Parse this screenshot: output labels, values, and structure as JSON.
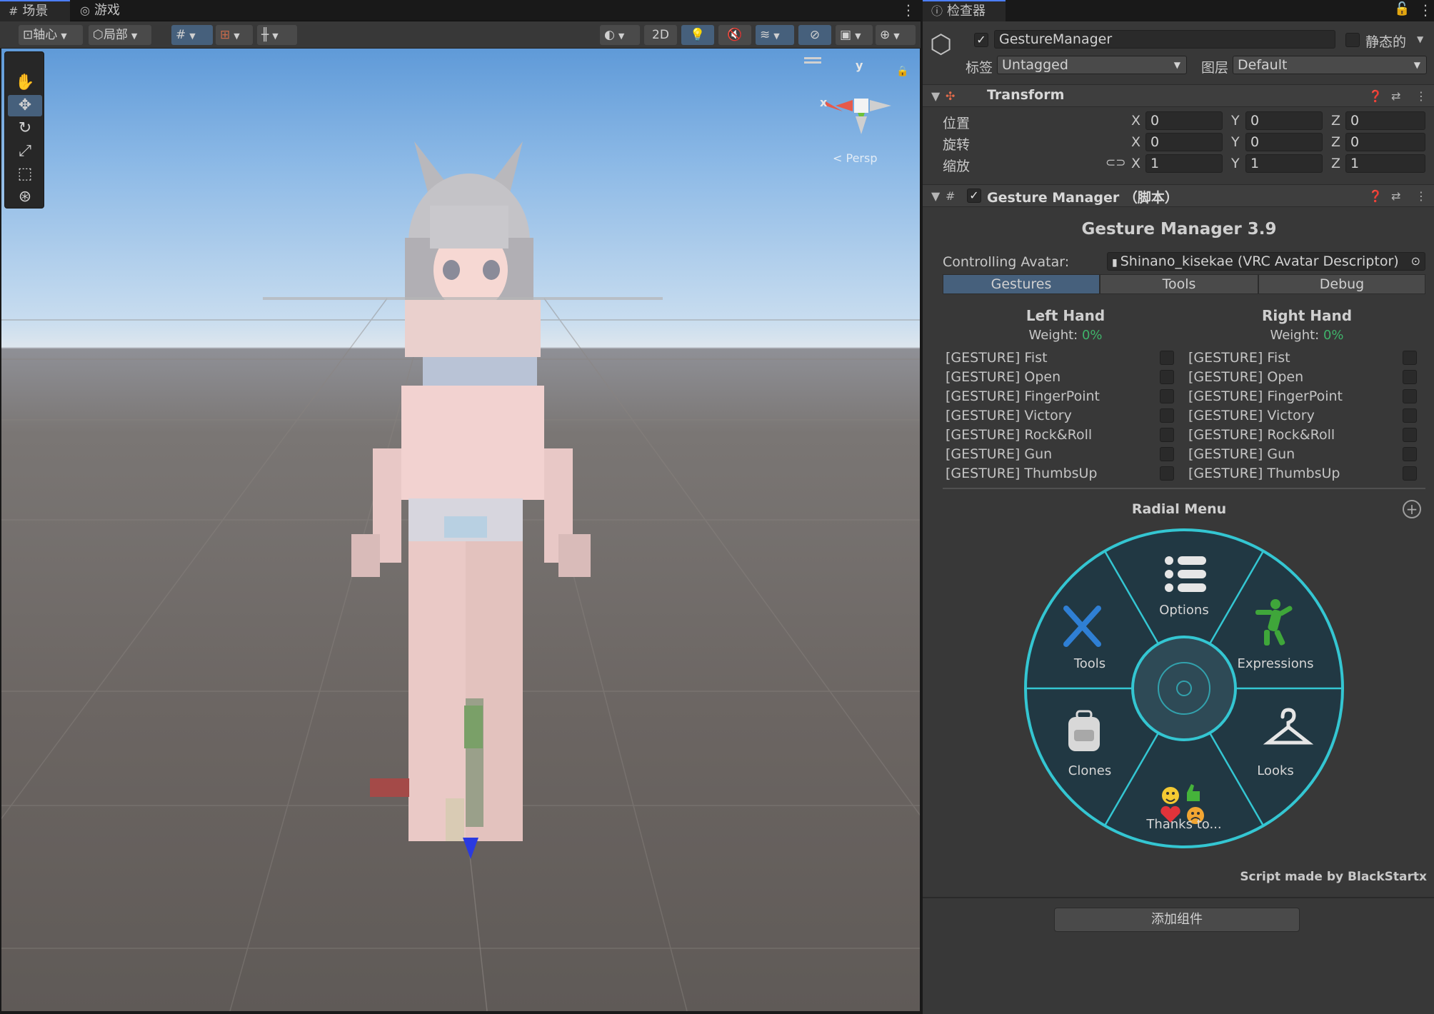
{
  "scene_tabs": {
    "scene": "场景",
    "game": "游戏"
  },
  "toolbar": {
    "pivot": "轴心",
    "local": "局部",
    "mode_2d": "2D"
  },
  "gizmo": {
    "y": "y",
    "x": "x",
    "persp": "< Persp"
  },
  "inspector": {
    "tab": "检查器",
    "object_name": "GestureManager",
    "static_label": "静态的",
    "tag_label": "标签",
    "tag_value": "Untagged",
    "layer_label": "图层",
    "layer_value": "Default"
  },
  "transform": {
    "title": "Transform",
    "position_label": "位置",
    "rotation_label": "旋转",
    "scale_label": "缩放",
    "axis": {
      "x": "X",
      "y": "Y",
      "z": "Z"
    },
    "position": {
      "x": "0",
      "y": "0",
      "z": "0"
    },
    "rotation": {
      "x": "0",
      "y": "0",
      "z": "0"
    },
    "scale": {
      "x": "1",
      "y": "1",
      "z": "1"
    }
  },
  "gesture_manager": {
    "header": "Gesture Manager （脚本）",
    "title": "Gesture Manager 3.9",
    "controlling_label": "Controlling Avatar:",
    "avatar_value": "Shinano_kisekae (VRC Avatar Descriptor)",
    "tabs": [
      "Gestures",
      "Tools",
      "Debug"
    ],
    "left_hand": {
      "title": "Left Hand",
      "weight_label": "Weight:",
      "weight_value": "0%"
    },
    "right_hand": {
      "title": "Right Hand",
      "weight_label": "Weight:",
      "weight_value": "0%"
    },
    "gestures": [
      "[GESTURE] Fist",
      "[GESTURE] Open",
      "[GESTURE] FingerPoint",
      "[GESTURE] Victory",
      "[GESTURE] Rock&Roll",
      "[GESTURE] Gun",
      "[GESTURE] ThumbsUp"
    ],
    "radial_title": "Radial Menu",
    "radial_items": {
      "options": "Options",
      "tools": "Tools",
      "expressions": "Expressions",
      "clones": "Clones",
      "looks": "Looks",
      "thanks": "Thanks to..."
    },
    "credit": "Script made by BlackStartx"
  },
  "add_component": "添加组件",
  "colors": {
    "accent": "#46607c",
    "weight_green": "#3fb36a",
    "radial_ring": "#34c6d2"
  }
}
